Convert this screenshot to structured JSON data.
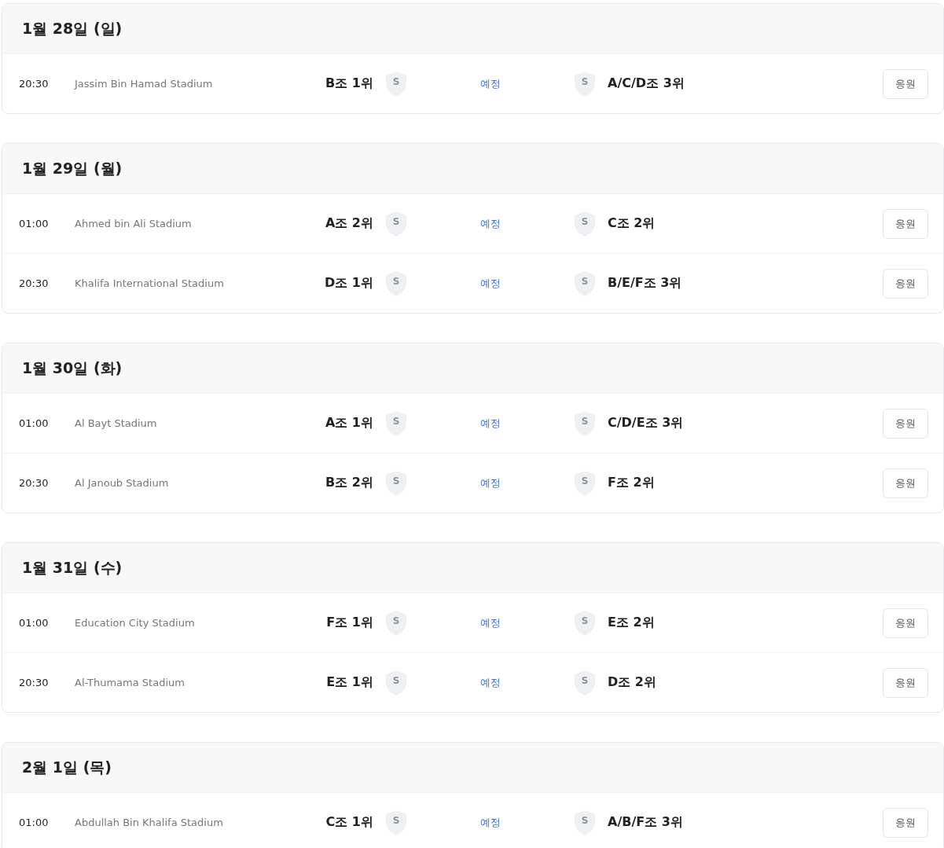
{
  "days": [
    {
      "date": "1월 28일 (일)",
      "matches": [
        {
          "time": "20:30",
          "venue": "Jassim Bin Hamad Stadium",
          "home": "B조 1위",
          "home_badge": "S",
          "status": "예정",
          "away_badge": "S",
          "away": "A/C/D조 3위",
          "button": "응원"
        }
      ]
    },
    {
      "date": "1월 29일 (월)",
      "matches": [
        {
          "time": "01:00",
          "venue": "Ahmed bin Ali Stadium",
          "home": "A조 2위",
          "home_badge": "S",
          "status": "예정",
          "away_badge": "S",
          "away": "C조 2위",
          "button": "응원"
        },
        {
          "time": "20:30",
          "venue": "Khalifa International Stadium",
          "home": "D조 1위",
          "home_badge": "S",
          "status": "예정",
          "away_badge": "S",
          "away": "B/E/F조 3위",
          "button": "응원"
        }
      ]
    },
    {
      "date": "1월 30일 (화)",
      "matches": [
        {
          "time": "01:00",
          "venue": "Al Bayt Stadium",
          "home": "A조 1위",
          "home_badge": "S",
          "status": "예정",
          "away_badge": "S",
          "away": "C/D/E조 3위",
          "button": "응원"
        },
        {
          "time": "20:30",
          "venue": "Al Janoub Stadium",
          "home": "B조 2위",
          "home_badge": "S",
          "status": "예정",
          "away_badge": "S",
          "away": "F조 2위",
          "button": "응원"
        }
      ]
    },
    {
      "date": "1월 31일 (수)",
      "matches": [
        {
          "time": "01:00",
          "venue": "Education City Stadium",
          "home": "F조 1위",
          "home_badge": "S",
          "status": "예정",
          "away_badge": "S",
          "away": "E조 2위",
          "button": "응원"
        },
        {
          "time": "20:30",
          "venue": "Al-Thumama Stadium",
          "home": "E조 1위",
          "home_badge": "S",
          "status": "예정",
          "away_badge": "S",
          "away": "D조 2위",
          "button": "응원"
        }
      ]
    },
    {
      "date": "2월 1일 (목)",
      "matches": [
        {
          "time": "01:00",
          "venue": "Abdullah Bin Khalifa Stadium",
          "home": "C조 1위",
          "home_badge": "S",
          "status": "예정",
          "away_badge": "S",
          "away": "A/B/F조 3위",
          "button": "응원"
        }
      ]
    }
  ]
}
